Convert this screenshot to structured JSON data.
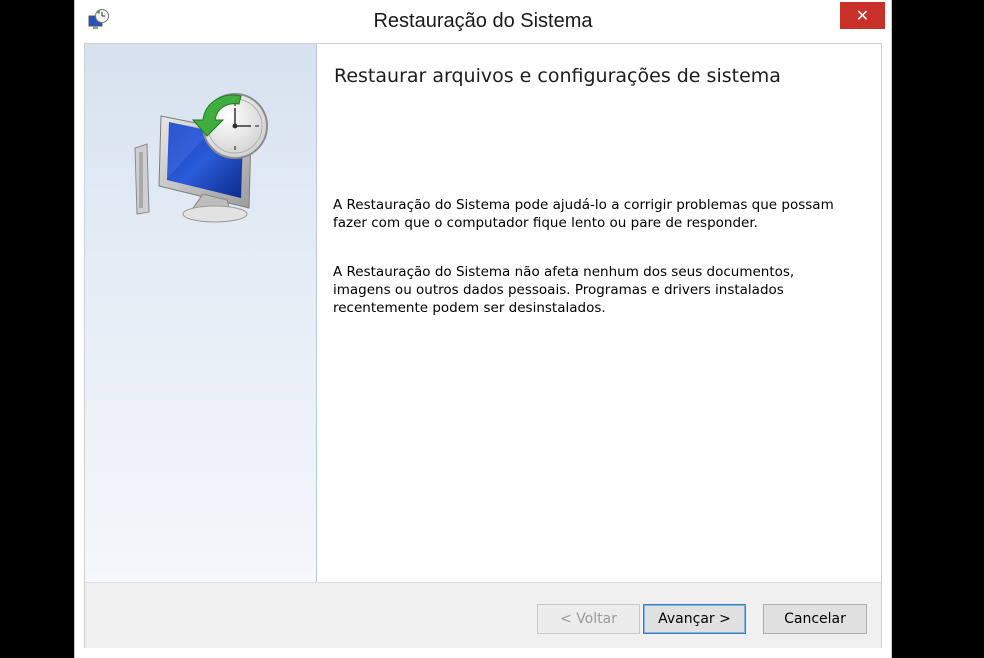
{
  "window": {
    "title": "Restauração do Sistema",
    "close_label": "✕"
  },
  "content": {
    "heading": "Restaurar arquivos e configurações de sistema",
    "paragraph1": "A Restauração do Sistema pode ajudá-lo a corrigir problemas que possam fazer com que o computador fique lento ou pare de responder.",
    "paragraph2": "A Restauração do Sistema não afeta nenhum dos seus documentos, imagens ou outros dados pessoais. Programas e drivers instalados recentemente podem ser desinstalados."
  },
  "buttons": {
    "back": "< Voltar",
    "next": "Avançar >",
    "cancel": "Cancelar"
  },
  "icons": {
    "app": "system-restore-icon",
    "hero": "system-restore-computer-clock-icon"
  },
  "colors": {
    "close_button": "#c7312a",
    "left_panel": "#d7e2f0",
    "default_button_border": "#3c7fb1"
  }
}
